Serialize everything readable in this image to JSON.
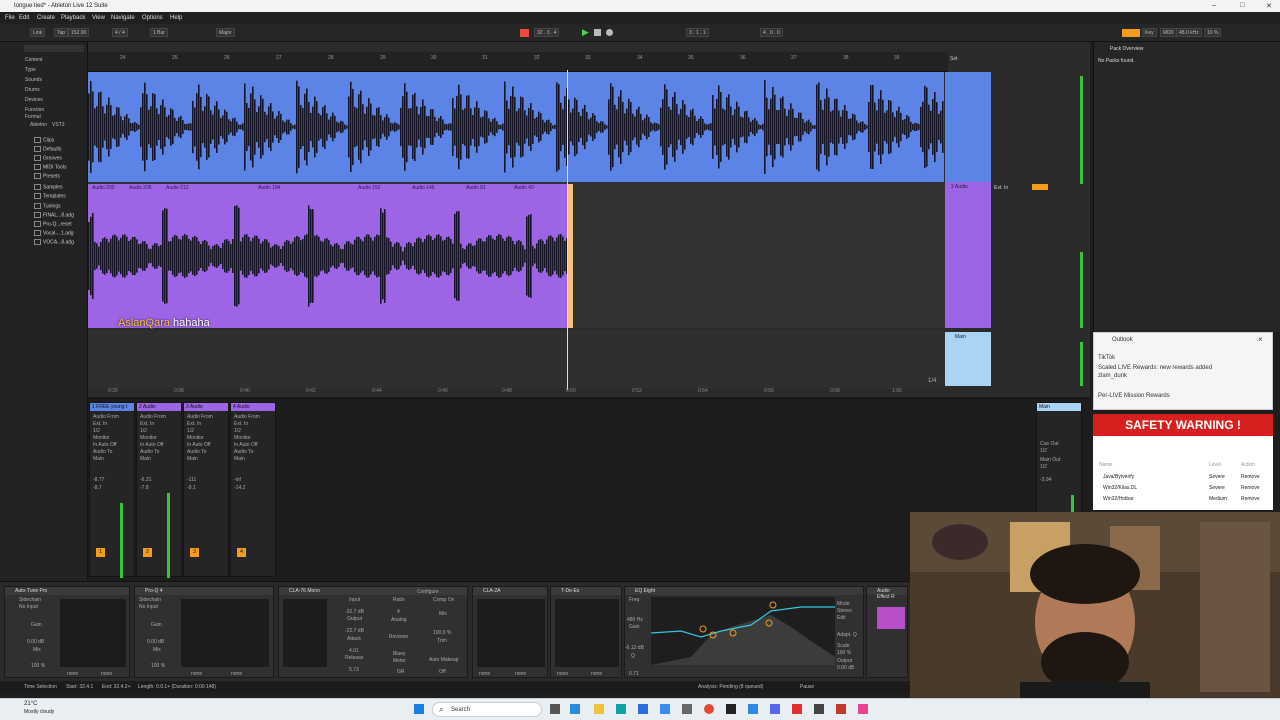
{
  "window": {
    "title": "tongue tied* - Ableton Live 12 Suite"
  },
  "menu": [
    "File",
    "Edit",
    "Create",
    "Playback",
    "View",
    "Navigate",
    "Options",
    "Help"
  ],
  "transport": {
    "link": "Link",
    "tap": "Tap",
    "tempo": "152.00",
    "signature": "4 / 4",
    "quantize": "1 Bar",
    "scale": "Major",
    "position": "32 . 3 . 4",
    "loop_start": "3 . 1 . 1",
    "loop_len": "4 . 0 . 0",
    "key": "Key",
    "midi": "MIDI",
    "sample_rate": "48.0 kHz",
    "cpu": "10 %"
  },
  "browser": {
    "categories": [
      "Content",
      "Type",
      "Sounds",
      "Drums",
      "Devices",
      "Function",
      "Format",
      "Ableton",
      "VST3"
    ],
    "files": [
      "Clips",
      "Defaults",
      "Grooves",
      "MIDI Tools",
      "Presets",
      "Samples",
      "Templates",
      "Tunings",
      "FINAL...8.adg",
      "Pro-Q...reset",
      "Vocal-...1.adg",
      "VOCA...8.adg"
    ]
  },
  "arrangement": {
    "bars": [
      "24",
      "25",
      "26",
      "27",
      "28",
      "29",
      "30",
      "31",
      "32",
      "33",
      "34",
      "35",
      "36",
      "37",
      "38",
      "39"
    ],
    "clips": [
      "Audio 200",
      "Audio 206",
      "Audio 212",
      "Audio 184",
      "Audio 152",
      "Audio 146",
      "Audio 81",
      "Audio 40"
    ],
    "times": [
      "0:36",
      "0:38",
      "0:40",
      "0:42",
      "0:44",
      "0:46",
      "0:48",
      "0:50",
      "0:52",
      "0:54",
      "0:56",
      "0:58",
      "1:00"
    ],
    "track_labels": [
      "2 Audio",
      "Main",
      "Ext. In",
      "Set"
    ],
    "grid": "1/4",
    "colors": {
      "track1": "#5b84e6",
      "track2": "#9e64e6",
      "main": "#a9d4f6",
      "playhead": "#f6c27a"
    }
  },
  "subtitle": {
    "user": "AslanQara",
    "text": "hahaha"
  },
  "mixer": {
    "strips": [
      {
        "name": "1 FREE young t",
        "io_from": "Audio From",
        "in": "Ext. In",
        "ch": "1/2",
        "monitor": "Monitor",
        "mon": "In Auto Off",
        "to": "Audio To",
        "out": "Main",
        "vol": "-8.77",
        "pk": "-8.7",
        "num": "1"
      },
      {
        "name": "2 Audio",
        "io_from": "Audio From",
        "in": "Ext. In",
        "ch": "1/2",
        "monitor": "Monitor",
        "mon": "In Auto Off",
        "to": "Audio To",
        "out": "Main",
        "vol": "-6.31",
        "pk": "-7.8",
        "num": "2"
      },
      {
        "name": "3 Audio",
        "io_from": "Audio From",
        "in": "Ext. In",
        "ch": "1/2",
        "monitor": "Monitor",
        "mon": "In Auto Off",
        "to": "Audio To",
        "out": "Main",
        "vol": "-111",
        "pk": "-9.1",
        "num": "3"
      },
      {
        "name": "4 Audio",
        "io_from": "Audio From",
        "in": "Ext. In",
        "ch": "1/2",
        "monitor": "Monitor",
        "mon": "In Auto Off",
        "to": "Audio To",
        "out": "Main",
        "vol": "-inf",
        "pk": "-14.2",
        "num": "4"
      }
    ],
    "main": {
      "name": "Main",
      "cue": "Cue Out",
      "cue_ch": "1/2",
      "main_out": "Main Out",
      "main_ch": "1/2",
      "vol": "-3.94"
    }
  },
  "devices": [
    {
      "name": "Auto-Tune Pro",
      "sidechain": "Sidechain",
      "input": "No Input",
      "gain": "Gain",
      "gain_val": "0.00 dB",
      "mix": "Mix",
      "mix_val": "100 %"
    },
    {
      "name": "Pro-Q 4",
      "sidechain": "Sidechain",
      "input": "No Input",
      "gain": "Gain",
      "gain_val": "0.00 dB",
      "mix": "Mix",
      "mix_val": "100 %"
    },
    {
      "name": "CLA-76 Mono",
      "input": "Input",
      "input_val": "-32.7 dB",
      "output": "Output",
      "output_val": "-22.7 dB",
      "attack": "Attack",
      "attack_val": "4.01",
      "release": "Release",
      "release_val": "5.73",
      "ratio": "Ratio",
      "ratio_val": "4",
      "analog": "Analog",
      "revision": "Revision",
      "bluey": "Bluey",
      "meter": "Meter",
      "gr": "GR",
      "configure": "Configure",
      "comp": "Comp On",
      "mixlbl": "Mix",
      "mix_val": "100.0 %",
      "trim": "Trim",
      "makeup": "Auto Makeup",
      "makeup_val": "Off"
    },
    {
      "name": "CLA-2A"
    },
    {
      "name": "T-De-Es"
    },
    {
      "name": "EQ Eight",
      "freq": "Freq",
      "freq_val": "480 Hz",
      "gain": "Gain",
      "gain_val": "-6.12 dB",
      "q": "Q",
      "q_val": "0.71",
      "mode": "Mode",
      "stereo": "Stereo",
      "edit": "Edit",
      "adapt": "Adapt. Q",
      "scale": "Scale",
      "scale_val": "100 %",
      "output": "Output",
      "output_val": "0.00 dB"
    },
    {
      "name": "Audio Effect R"
    }
  ],
  "none": "none",
  "status": {
    "selection": "Time Selection",
    "start": "Start: 32.4.1",
    "end": "End: 32.4.2+",
    "length": "Length: 0.0.1+ (Duration: 0:00:148)",
    "analysis": "Analysis: Pending (8 queued)",
    "pause": "Pause"
  },
  "pack": {
    "title": "Pack Overview",
    "empty": "No Packs found."
  },
  "notification": {
    "app": "Outlook",
    "source": "TikTok",
    "line1": "Scaled LIVE Rewards: new rewards added",
    "line2": "zlam_dunk",
    "footer": "Per-LIVE Mission Rewards"
  },
  "warning": {
    "title": "SAFETY WARNING !",
    "cols": [
      "Name",
      "Level",
      "Action"
    ],
    "rows": [
      [
        "Java/Bytverify",
        "Severe",
        "Remove"
      ],
      [
        "Win32/Kilas.DL",
        "Severe",
        "Remove"
      ],
      [
        "Win32/Hotbar",
        "Medium",
        "Remove"
      ]
    ]
  },
  "taskbar": {
    "temp": "21°C",
    "weather": "Mostly cloudy",
    "search": "Search"
  }
}
